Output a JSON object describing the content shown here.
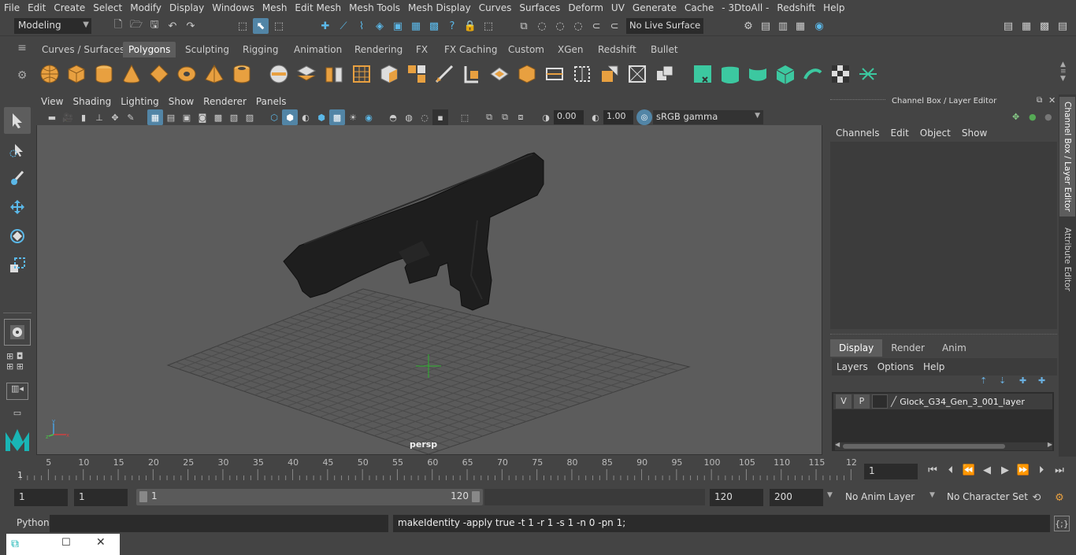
{
  "menubar": {
    "items": [
      "File",
      "Edit",
      "Create",
      "Select",
      "Modify",
      "Display",
      "Windows",
      "Mesh",
      "Edit Mesh",
      "Mesh Tools",
      "Mesh Display",
      "Curves",
      "Surfaces",
      "Deform",
      "UV",
      "Generate",
      "Cache",
      "- 3DtoAll -",
      "Redshift",
      "Help"
    ]
  },
  "statusline": {
    "mode": "Modeling",
    "live_surface": "No Live Surface"
  },
  "shelf": {
    "tabs": [
      "Curves / Surfaces",
      "Polygons",
      "Sculpting",
      "Rigging",
      "Animation",
      "Rendering",
      "FX",
      "FX Caching",
      "Custom",
      "XGen",
      "Redshift",
      "Bullet"
    ],
    "active_tab": "Polygons"
  },
  "viewport": {
    "menu": [
      "View",
      "Shading",
      "Lighting",
      "Show",
      "Renderer",
      "Panels"
    ],
    "exposure": "0.00",
    "gamma": "1.00",
    "color_space": "sRGB gamma",
    "camera_label": "persp"
  },
  "channel_box": {
    "title": "Channel Box / Layer Editor",
    "menu": [
      "Channels",
      "Edit",
      "Object",
      "Show"
    ],
    "layer_tabs": [
      "Display",
      "Render",
      "Anim"
    ],
    "active_layer_tab": "Display",
    "layer_menu": [
      "Layers",
      "Options",
      "Help"
    ],
    "layer": {
      "v": "V",
      "p": "P",
      "name": "Glock_G34_Gen_3_001_layer"
    }
  },
  "side_tabs": [
    "Channel Box / Layer Editor",
    "Attribute Editor"
  ],
  "timeline": {
    "ticks": [
      "5",
      "10",
      "15",
      "20",
      "25",
      "30",
      "35",
      "40",
      "45",
      "50",
      "55",
      "60",
      "65",
      "70",
      "75",
      "80",
      "85",
      "90",
      "95",
      "100",
      "105",
      "110",
      "115",
      "12"
    ],
    "start_marker": "1",
    "current_frame": "1"
  },
  "range": {
    "start": "1",
    "playback_start": "1",
    "slider_start": "1",
    "slider_end": "120",
    "playback_end": "120",
    "end": "200",
    "anim_layer": "No Anim Layer",
    "character_set": "No Character Set"
  },
  "command": {
    "language": "Python",
    "output": "makeIdentity -apply true -t 1 -r 1 -s 1 -n 0 -pn 1;"
  },
  "colors": {
    "accent": "#5285a6",
    "poly_icon": "#e8a040",
    "shelf_green": "#3cc8a0",
    "panel": "#444444",
    "field": "#2b2b2b"
  }
}
